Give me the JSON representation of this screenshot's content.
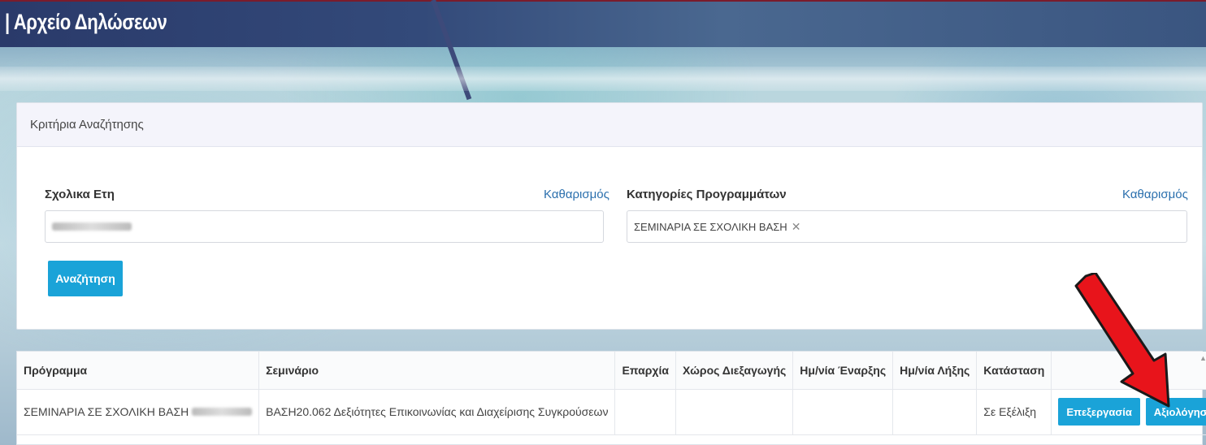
{
  "page": {
    "title": "| Αρχείο Δηλώσεων"
  },
  "criteria": {
    "header": "Κριτήρια Αναζήτησης",
    "years": {
      "label": "Σχολικα Ετη",
      "clear": "Καθαρισμός",
      "chip": ""
    },
    "categories": {
      "label": "Κατηγορίες Προγραμμάτων",
      "clear": "Καθαρισμός",
      "chip": "ΣΕΜΙΝΑΡΙΑ ΣΕ ΣΧΟΛΙΚΗ ΒΑΣΗ"
    },
    "search_button": "Αναζήτηση"
  },
  "table": {
    "columns": [
      "Πρόγραμμα",
      "Σεμινάριο",
      "Επαρχία",
      "Χώρος Διεξαγωγής",
      "Ημ/νία Έναρξης",
      "Ημ/νία Λήξης",
      "Κατάσταση",
      ""
    ],
    "rows": [
      {
        "program": "ΣΕΜΙΝΑΡΙΑ ΣΕ ΣΧΟΛΙΚΗ ΒΑΣΗ",
        "seminar": "ΒΑΣΗ20.062 Δεξιότητες Επικοινωνίας και Διαχείρισης Συγκρούσεων",
        "province": "",
        "venue": "",
        "start_date": "",
        "end_date": "",
        "status": "Σε Εξέλιξη",
        "edit_label": "Επεξεργασία",
        "evaluate_label": "Αξιολόγηση"
      }
    ]
  },
  "colors": {
    "accent": "#1aa3d8",
    "arrow": "#e8141b",
    "link": "#2a6fad"
  },
  "icons": {
    "chip_remove": "close-icon",
    "annotation": "red-arrow-icon"
  }
}
